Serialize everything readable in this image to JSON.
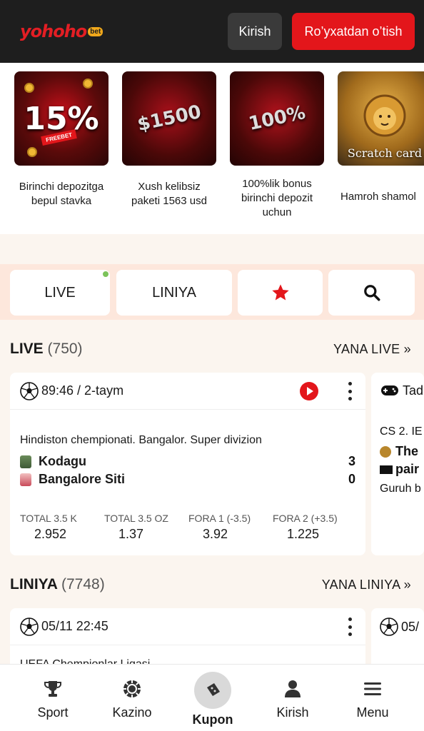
{
  "header": {
    "logo_text": "yohoho",
    "logo_badge": "bet",
    "login_label": "Kirish",
    "register_label": "Ro’yxatdan o’tish"
  },
  "promos": [
    {
      "title": "Birinchi depozitga bepul stavka",
      "art_text": "15%",
      "tag": "FREEBET"
    },
    {
      "title": "Xush kelibsiz paketi 1563 usd",
      "art_text": "$1500"
    },
    {
      "title": "100%lik bonus birinchi depozit uchun",
      "art_text": "100%"
    },
    {
      "title": "Hamroh shamol",
      "art_text": "Scratch card"
    }
  ],
  "tabs": {
    "live": "LIVE",
    "liniya": "LINIYA",
    "favorites_icon": "star-icon",
    "search_icon": "search-icon"
  },
  "live_section": {
    "title": "LIVE",
    "count": "(750)",
    "more": "YANA LIVE »"
  },
  "live_card": {
    "time": "89:46 / 2-taym",
    "league": "Hindiston chempionati. Bangalor. Super divizion",
    "team1": "Kodagu",
    "team2": "Bangalore Siti",
    "score1": "3",
    "score2": "0",
    "odds": [
      {
        "label": "TOTAL 3.5 K",
        "value": "2.952"
      },
      {
        "label": "TOTAL 3.5 OZ",
        "value": "1.37"
      },
      {
        "label": "FORA 1 (-3.5)",
        "value": "3.92"
      },
      {
        "label": "FORA 2 (+3.5)",
        "value": "1.225"
      }
    ]
  },
  "live_side_card": {
    "sport_label": "Tad",
    "league": "CS 2. IE",
    "team1": "The",
    "team2": "pair",
    "sub": "Guruh b"
  },
  "liniya_section": {
    "title": "LINIYA",
    "count": "(7748)",
    "more": "YANA LINIYA »"
  },
  "liniya_card": {
    "time": "05/11 22:45",
    "league_partial": "UEFA Chempionlar Ligasi"
  },
  "liniya_side_card": {
    "time": "05/"
  },
  "bottom_nav": [
    {
      "label": "Sport",
      "icon": "trophy-icon"
    },
    {
      "label": "Kazino",
      "icon": "casino-chip-icon"
    },
    {
      "label": "Kupon",
      "icon": "ticket-icon"
    },
    {
      "label": "Kirish",
      "icon": "user-icon"
    },
    {
      "label": "Menu",
      "icon": "menu-icon"
    }
  ],
  "colors": {
    "accent": "#e3161b",
    "header_bg": "#1e1e1e",
    "page_bg": "#fbf5ef",
    "tabs_bg": "#fde7dc"
  }
}
